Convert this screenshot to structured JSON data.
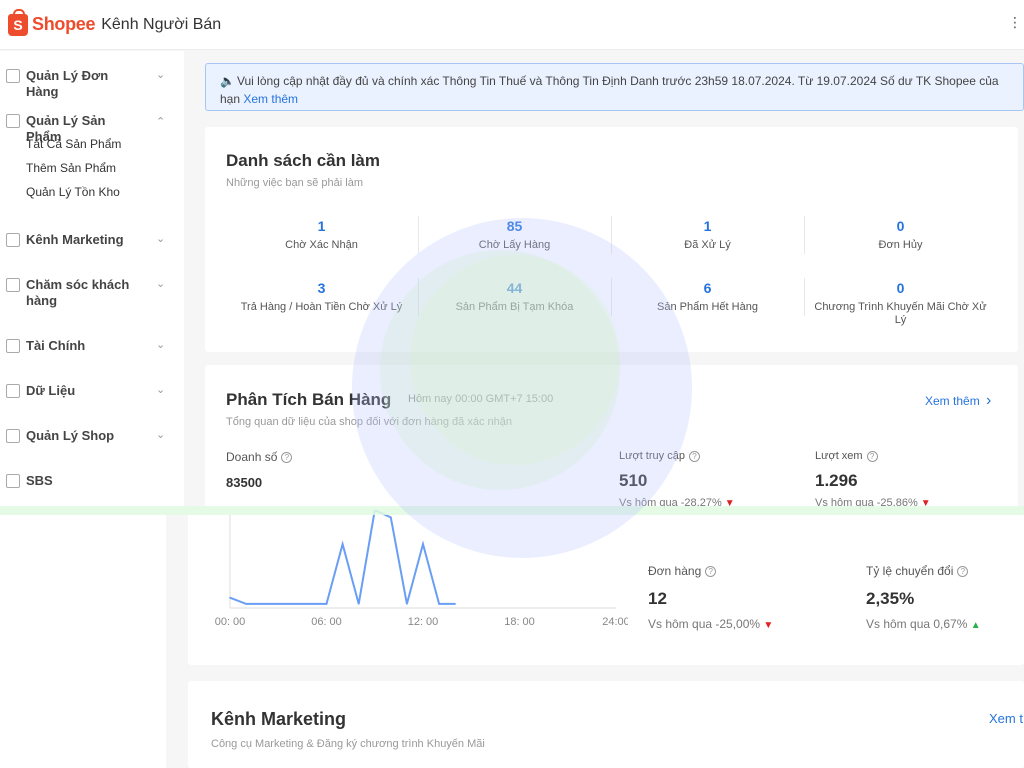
{
  "header": {
    "logo_letter": "S",
    "logo_word": "Shopee",
    "title": "Kênh Người Bán",
    "menu_glyph": "⋮"
  },
  "sidebar": {
    "groups": [
      {
        "label": "Quản Lý Đơn Hàng",
        "icon": "clipboard-icon",
        "chevron": "⌄"
      },
      {
        "label": "Quản Lý Sản Phẩm",
        "icon": "bag-icon",
        "chevron": "⌃",
        "items": [
          "Tất Cả Sản Phẩm",
          "Thêm Sản Phẩm",
          "Quản Lý Tồn Kho"
        ]
      },
      {
        "label": "Kênh Marketing",
        "icon": "tag-icon",
        "chevron": "⌄"
      },
      {
        "label": "Chăm sóc khách hàng",
        "icon": "chat-icon",
        "chevron": "⌄"
      },
      {
        "label": "Tài Chính",
        "icon": "wallet-icon",
        "chevron": "⌄"
      },
      {
        "label": "Dữ Liệu",
        "icon": "chart-icon",
        "chevron": "⌄"
      },
      {
        "label": "Quản Lý Shop",
        "icon": "shop-icon",
        "chevron": "⌄"
      },
      {
        "label": "SBS",
        "icon": "box-icon",
        "chevron": ""
      }
    ]
  },
  "notice": {
    "text": "Vui lòng cập nhật đầy đủ và chính xác Thông Tin Thuế và Thông Tin Định Danh trước 23h59 18.07.2024. Từ 19.07.2024 Số dư TK Shopee của",
    "text2": "hạn ",
    "link": "Xem thêm"
  },
  "todo": {
    "title": "Danh sách cần làm",
    "subtitle": "Những việc bạn sẽ phải làm",
    "items": [
      {
        "value": "1",
        "label": "Chờ Xác Nhận"
      },
      {
        "value": "85",
        "label": "Chờ Lấy Hàng"
      },
      {
        "value": "1",
        "label": "Đã Xử Lý"
      },
      {
        "value": "0",
        "label": "Đơn Hủy"
      },
      {
        "value": "3",
        "label": "Trả Hàng / Hoàn Tiền Chờ Xử Lý"
      },
      {
        "value": "44",
        "label": "Sản Phẩm Bị Tạm Khóa"
      },
      {
        "value": "6",
        "label": "Sản Phẩm Hết Hàng"
      },
      {
        "value": "0",
        "label": "Chương Trình Khuyến Mãi Chờ Xử Lý"
      }
    ]
  },
  "sales": {
    "title": "Phân Tích Bán Hàng",
    "time": "Hôm nay 00:00 GMT+7 15:00",
    "subtitle": "Tổng quan dữ liệu của shop đối với đơn hàng đã xác nhận",
    "see_more": "Xem thêm",
    "see_more_chevron": "›",
    "revenue_label": "Doanh số",
    "revenue_value": "83500",
    "visits_label": "Lượt truy cập",
    "visits_value": "510",
    "visits_compare": "Vs hôm qua -28,27%",
    "views_label": "Lượt xem",
    "views_value": "1.296",
    "views_compare": "Vs hôm qua -25,86%",
    "orders_label": "Đơn hàng",
    "orders_value": "12",
    "orders_compare": "Vs hôm qua -25,00%",
    "conversion_label": "Tỷ lệ chuyển đổi",
    "conversion_value": "2,35%",
    "conversion_compare": "Vs hôm qua 0,67%",
    "help_glyph": "?",
    "down_arrow": "▼",
    "up_arrow": "▲"
  },
  "marketing": {
    "title": "Kênh Marketing",
    "subtitle": "Công cụ Marketing & Đăng ký chương trình Khuyến Mãi",
    "see_more": "Xem t"
  },
  "chart_data": {
    "type": "line",
    "x_ticks": [
      "00: 00",
      "06: 00",
      "12: 00",
      "18: 00",
      "24:00"
    ],
    "x_hours": [
      0,
      1,
      2,
      3,
      4,
      5,
      6,
      7,
      8,
      9,
      10,
      11,
      12,
      13,
      14
    ],
    "values": [
      1.0,
      0.4,
      0.4,
      0.4,
      0.4,
      0.4,
      0.4,
      6.2,
      0.4,
      9.5,
      8.8,
      0.4,
      6.2,
      0.4,
      0.4
    ],
    "xlim": [
      0,
      24
    ],
    "ylim": [
      0,
      10
    ],
    "color": "#6a9ef5",
    "grid": false
  },
  "colors": {
    "brand": "#ee4d2d",
    "link": "#2673dd",
    "up": "#24b24a",
    "down": "#e02020"
  }
}
